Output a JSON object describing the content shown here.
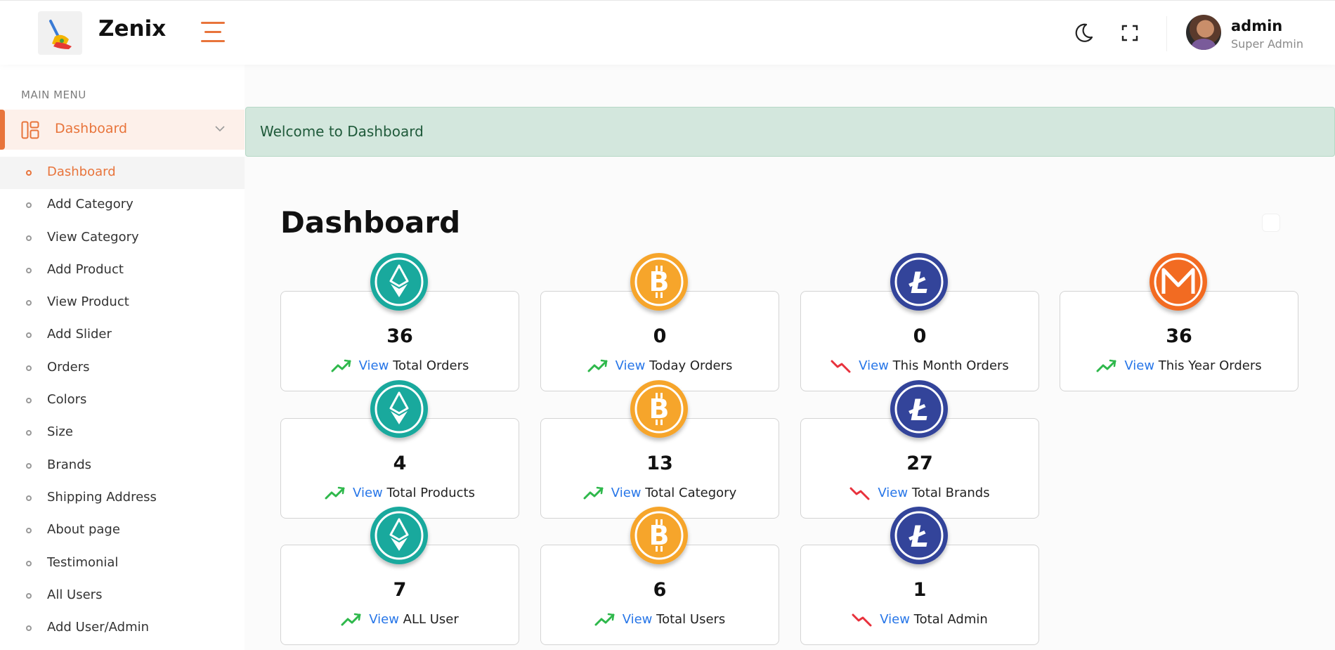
{
  "header": {
    "brand": "Zenix",
    "user_name": "admin",
    "user_role": "Super Admin"
  },
  "sidebar": {
    "menu_title": "MAIN MENU",
    "parent_label": "Dashboard",
    "items": [
      {
        "label": "Dashboard",
        "active": true
      },
      {
        "label": "Add Category"
      },
      {
        "label": "View Category"
      },
      {
        "label": "Add Product"
      },
      {
        "label": "View Product"
      },
      {
        "label": "Add Slider"
      },
      {
        "label": "Orders"
      },
      {
        "label": "Colors"
      },
      {
        "label": "Size"
      },
      {
        "label": "Brands"
      },
      {
        "label": "Shipping Address"
      },
      {
        "label": "About page"
      },
      {
        "label": "Testimonial"
      },
      {
        "label": "All Users"
      },
      {
        "label": "Add User/Admin"
      }
    ]
  },
  "main": {
    "alert": "Welcome to Dashboard",
    "title": "Dashboard",
    "view_label": "View",
    "cards": [
      {
        "value": "36",
        "label": "Total Orders",
        "coin": "ethereum",
        "trend": "up"
      },
      {
        "value": "0",
        "label": "Today Orders",
        "coin": "bitcoin",
        "trend": "up"
      },
      {
        "value": "0",
        "label": "This Month Orders",
        "coin": "litecoin",
        "trend": "down"
      },
      {
        "value": "36",
        "label": "This Year Orders",
        "coin": "monero",
        "trend": "up"
      },
      {
        "value": "4",
        "label": "Total Products",
        "coin": "ethereum",
        "trend": "up"
      },
      {
        "value": "13",
        "label": "Total Category",
        "coin": "bitcoin",
        "trend": "up"
      },
      {
        "value": "27",
        "label": "Total Brands",
        "coin": "litecoin",
        "trend": "down"
      },
      {
        "value": "7",
        "label": "ALL User",
        "coin": "ethereum",
        "trend": "up"
      },
      {
        "value": "6",
        "label": "Total Users",
        "coin": "bitcoin",
        "trend": "up"
      },
      {
        "value": "1",
        "label": "Total Admin",
        "coin": "litecoin",
        "trend": "down"
      }
    ]
  },
  "colors": {
    "accent": "#e8743b",
    "link": "#2776e8",
    "ethereum": "#19a99d",
    "bitcoin": "#f6a52b",
    "litecoin": "#33449a",
    "monero": "#f26b22",
    "trend_up": "#2eb84b",
    "trend_down": "#e8313c"
  }
}
